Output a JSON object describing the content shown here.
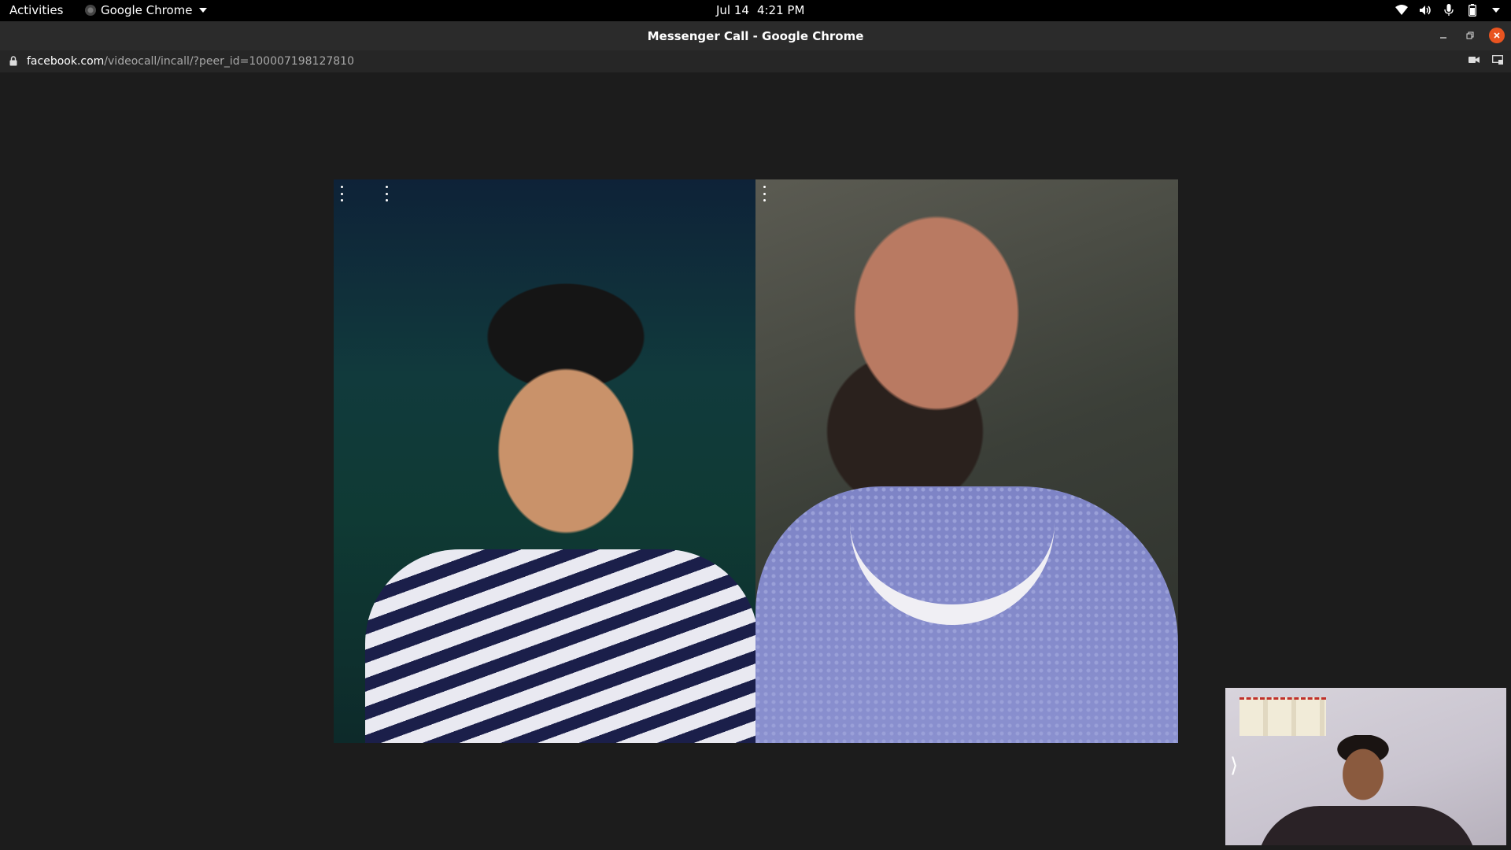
{
  "topbar": {
    "activities": "Activities",
    "app_name": "Google Chrome",
    "date": "Jul 14",
    "time": "4:21 PM",
    "tray_icons": [
      "wifi-icon",
      "volume-icon",
      "microphone-icon",
      "battery-icon",
      "system-menu-caret-icon"
    ]
  },
  "window": {
    "title": "Messenger Call - Google Chrome",
    "buttons": [
      "minimize",
      "restore",
      "close"
    ]
  },
  "urlbar": {
    "domain": "facebook.com",
    "path": "/videocall/incall/?peer_id=100007198127810",
    "right_icons": [
      "camera-in-use-icon",
      "cast-icon"
    ]
  },
  "call": {
    "participants": [
      {
        "tile": "left",
        "menu_icon": "more-options-icon"
      },
      {
        "tile": "right",
        "menu_icon": "more-options-icon"
      }
    ],
    "self_view": {
      "expand_glyph": "⟩"
    }
  },
  "colors": {
    "topbar_bg": "#000000",
    "titlebar_bg": "#2b2b2b",
    "close_button": "#e95420",
    "page_bg": "#1c1c1c"
  }
}
